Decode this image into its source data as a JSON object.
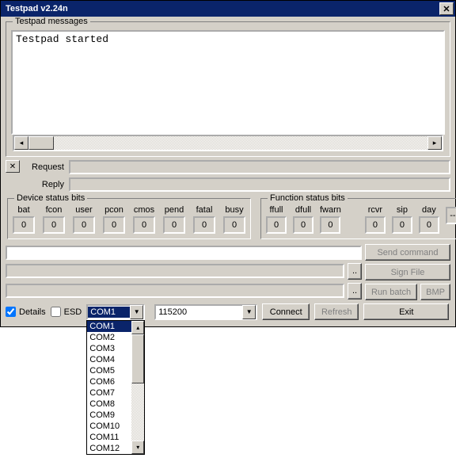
{
  "title": "Testpad v2.24n",
  "messages_caption": "Testpad messages",
  "messages_text": "Testpad started",
  "request_label": "Request",
  "reply_label": "Reply",
  "device_status": {
    "caption": "Device status bits",
    "cols": [
      {
        "label": "bat",
        "value": "0"
      },
      {
        "label": "fcon",
        "value": "0"
      },
      {
        "label": "user",
        "value": "0"
      },
      {
        "label": "pcon",
        "value": "0"
      },
      {
        "label": "cmos",
        "value": "0"
      },
      {
        "label": "pend",
        "value": "0"
      },
      {
        "label": "fatal",
        "value": "0"
      },
      {
        "label": "busy",
        "value": "0"
      }
    ]
  },
  "function_status": {
    "caption": "Function status bits",
    "cols": [
      {
        "label": "ffull",
        "value": "0"
      },
      {
        "label": "dfull",
        "value": "0"
      },
      {
        "label": "fwarn",
        "value": "0"
      },
      {
        "label": "",
        "value": ""
      },
      {
        "label": "rcvr",
        "value": "0"
      },
      {
        "label": "sip",
        "value": "0"
      },
      {
        "label": "day",
        "value": "0"
      },
      {
        "label": "",
        "value": "--"
      }
    ]
  },
  "buttons": {
    "send_command": "Send command",
    "sign_file": "Sign File",
    "run_batch": "Run batch",
    "bmp": "BMP",
    "connect": "Connect",
    "refresh": "Refresh",
    "exit": "Exit",
    "dots": ".."
  },
  "checkboxes": {
    "details": "Details",
    "esd": "ESD"
  },
  "combos": {
    "com": {
      "value": "COM1",
      "options": [
        "COM1",
        "COM2",
        "COM3",
        "COM4",
        "COM5",
        "COM6",
        "COM7",
        "COM8",
        "COM9",
        "COM10",
        "COM11",
        "COM12"
      ]
    },
    "baud": {
      "value": "115200"
    }
  }
}
